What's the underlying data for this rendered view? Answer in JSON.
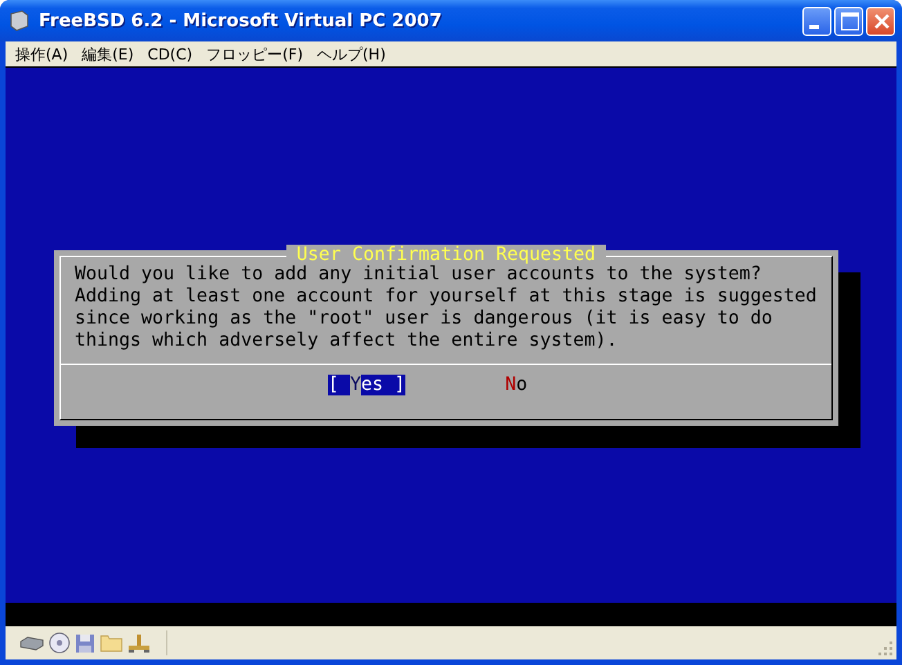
{
  "window": {
    "title": "FreeBSD 6.2 - Microsoft Virtual PC 2007"
  },
  "menu": [
    "操作(A)",
    "編集(E)",
    "CD(C)",
    "フロッピー(F)",
    "ヘルプ(H)"
  ],
  "dialog": {
    "title": "User Confirmation Requested",
    "message": "Would you like to add any initial user accounts to the system?\nAdding at least one account for yourself at this stage is suggested\nsince working as the \"root\" user is dangerous (it is easy to do\nthings which adversely affect the entire system).",
    "buttons": [
      {
        "prefix": "[ ",
        "hotkey": "Y",
        "rest": "es ]",
        "selected": true
      },
      {
        "hotkey": "N",
        "rest": "o",
        "selected": false
      }
    ]
  }
}
